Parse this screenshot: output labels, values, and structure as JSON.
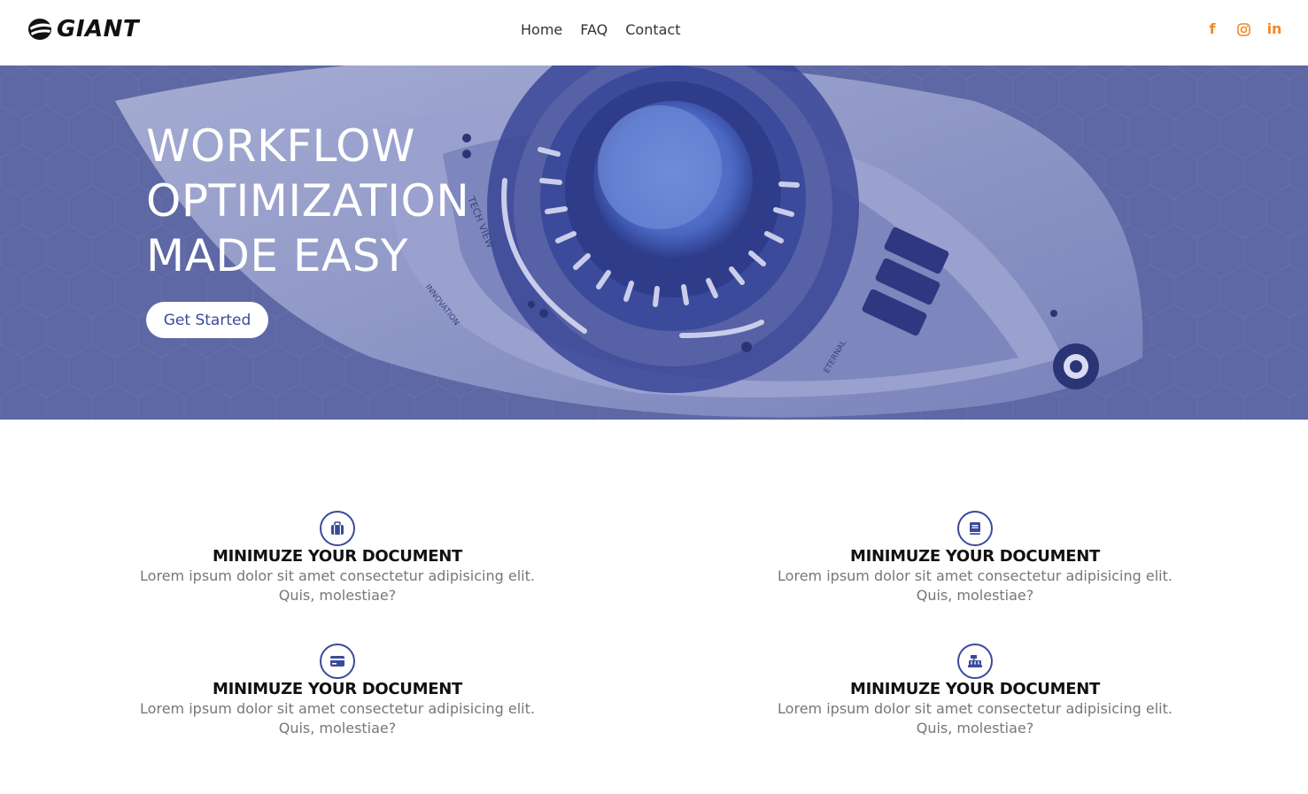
{
  "header": {
    "logo_text": "GIANT",
    "nav": [
      {
        "label": "Home"
      },
      {
        "label": "FAQ"
      },
      {
        "label": "Contact"
      }
    ],
    "social": [
      {
        "icon": "facebook-icon",
        "glyph": "f"
      },
      {
        "icon": "instagram-icon",
        "glyph": ""
      },
      {
        "icon": "linkedin-icon",
        "glyph": "in"
      }
    ],
    "accent_color": "#f08a24"
  },
  "hero": {
    "title_lines": [
      "WORKFLOW",
      "OPTIMIZATION",
      "MADE EASY"
    ],
    "cta_label": "Get Started",
    "overlay_color": "#5d68a4",
    "image_labels": [
      "TECH VIEW",
      "INNOVATION",
      "ETERNAL"
    ]
  },
  "features": [
    {
      "icon": "briefcase-icon",
      "title": "MINIMUZE YOUR DOCUMENT",
      "text": "Lorem ipsum dolor sit amet consectetur adipisicing elit. Quis, molestiae?"
    },
    {
      "icon": "book-icon",
      "title": "MINIMUZE YOUR DOCUMENT",
      "text": "Lorem ipsum dolor sit amet consectetur adipisicing elit. Quis, molestiae?"
    },
    {
      "icon": "credit-card-icon",
      "title": "MINIMUZE YOUR DOCUMENT",
      "text": "Lorem ipsum dolor sit amet consectetur adipisicing elit. Quis, molestiae?"
    },
    {
      "icon": "cash-register-icon",
      "title": "MINIMUZE YOUR DOCUMENT",
      "text": "Lorem ipsum dolor sit amet consectetur adipisicing elit. Quis, molestiae?"
    }
  ],
  "brand_color": "#3b4a9b"
}
